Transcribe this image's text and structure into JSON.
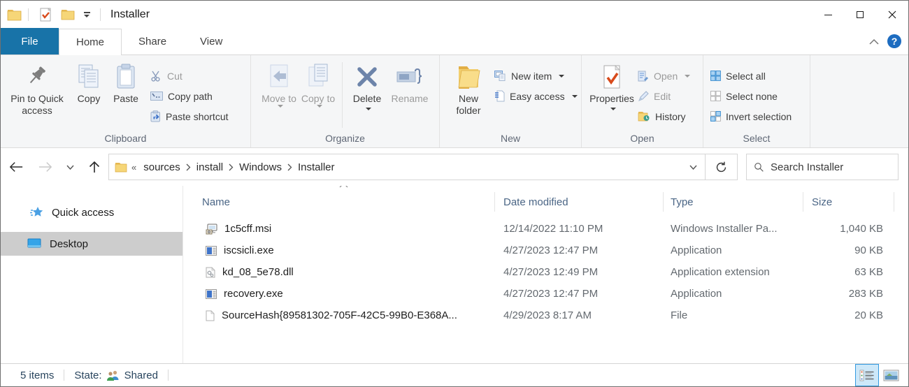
{
  "window": {
    "title": "Installer"
  },
  "tabs": {
    "file": "File",
    "home": "Home",
    "share": "Share",
    "view": "View"
  },
  "ribbon": {
    "clipboard": {
      "label": "Clipboard",
      "pin": "Pin to Quick access",
      "copy": "Copy",
      "paste": "Paste",
      "cut": "Cut",
      "copy_path": "Copy path",
      "paste_shortcut": "Paste shortcut"
    },
    "organize": {
      "label": "Organize",
      "move_to": "Move to",
      "copy_to": "Copy to",
      "delete": "Delete",
      "rename": "Rename"
    },
    "new_group": {
      "label": "New",
      "new_folder": "New folder",
      "new_item": "New item",
      "easy_access": "Easy access"
    },
    "open_group": {
      "label": "Open",
      "properties": "Properties",
      "open": "Open",
      "edit": "Edit",
      "history": "History"
    },
    "select_group": {
      "label": "Select",
      "select_all": "Select all",
      "select_none": "Select none",
      "invert": "Invert selection"
    }
  },
  "address": {
    "overflow_mark": "«",
    "crumbs": [
      "sources",
      "install",
      "Windows",
      "Installer"
    ],
    "search_placeholder": "Search Installer"
  },
  "sidebar": {
    "quick_access": "Quick access",
    "desktop": "Desktop"
  },
  "filelist": {
    "columns": {
      "name": "Name",
      "date": "Date modified",
      "type": "Type",
      "size": "Size"
    },
    "rows": [
      {
        "icon": "msi-file-icon",
        "name": "1c5cff.msi",
        "date": "12/14/2022 11:10 PM",
        "type": "Windows Installer Pa...",
        "size": "1,040 KB"
      },
      {
        "icon": "exe-file-icon",
        "name": "iscsicli.exe",
        "date": "4/27/2023 12:47 PM",
        "type": "Application",
        "size": "90 KB"
      },
      {
        "icon": "dll-file-icon",
        "name": "kd_08_5e78.dll",
        "date": "4/27/2023 12:49 PM",
        "type": "Application extension",
        "size": "63 KB"
      },
      {
        "icon": "exe-file-icon",
        "name": "recovery.exe",
        "date": "4/27/2023 12:47 PM",
        "type": "Application",
        "size": "283 KB"
      },
      {
        "icon": "generic-file-icon",
        "name": "SourceHash{89581302-705F-42C5-99B0-E368A...",
        "date": "4/29/2023 8:17 AM",
        "type": "File",
        "size": "20 KB"
      }
    ]
  },
  "statusbar": {
    "items_count": "5 items",
    "state_label": "State:",
    "state_value": "Shared"
  },
  "colors": {
    "file_tab_blue": "#1873a8",
    "help_blue": "#1d6cc0",
    "selection_gray": "#cdcdcd",
    "header_text_blue": "#4a6585",
    "properties_check_orange": "#d84a1b",
    "folder_yellow": "#f6d678"
  }
}
